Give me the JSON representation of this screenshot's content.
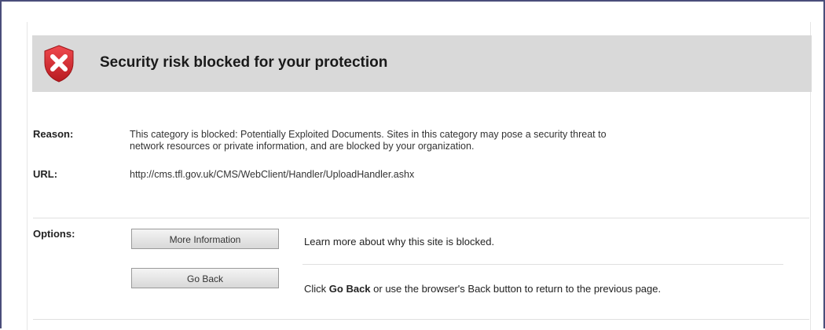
{
  "header": {
    "title": "Security risk blocked for your protection",
    "icon": "shield-x-icon",
    "icon_color": "#d9262c"
  },
  "reason": {
    "label": "Reason:",
    "line1": "This category is blocked: Potentially Exploited Documents. Sites in this category may pose a security threat to",
    "line2": "network resources or private information, and are blocked by your organization."
  },
  "url": {
    "label": "URL:",
    "value": "http://cms.tfl.gov.uk/CMS/WebClient/Handler/UploadHandler.ashx"
  },
  "options": {
    "label": "Options:",
    "more_info_button": "More Information",
    "more_info_text": "Learn more about why this site is blocked.",
    "go_back_button": "Go Back",
    "go_back_text_pre": "Click ",
    "go_back_text_bold": "Go Back",
    "go_back_text_post": " or use the browser's Back button to return to the previous page."
  },
  "colors": {
    "header_bg": "#d9d9d9",
    "frame_border": "#4a4e7a",
    "shield_red": "#d9262c"
  }
}
